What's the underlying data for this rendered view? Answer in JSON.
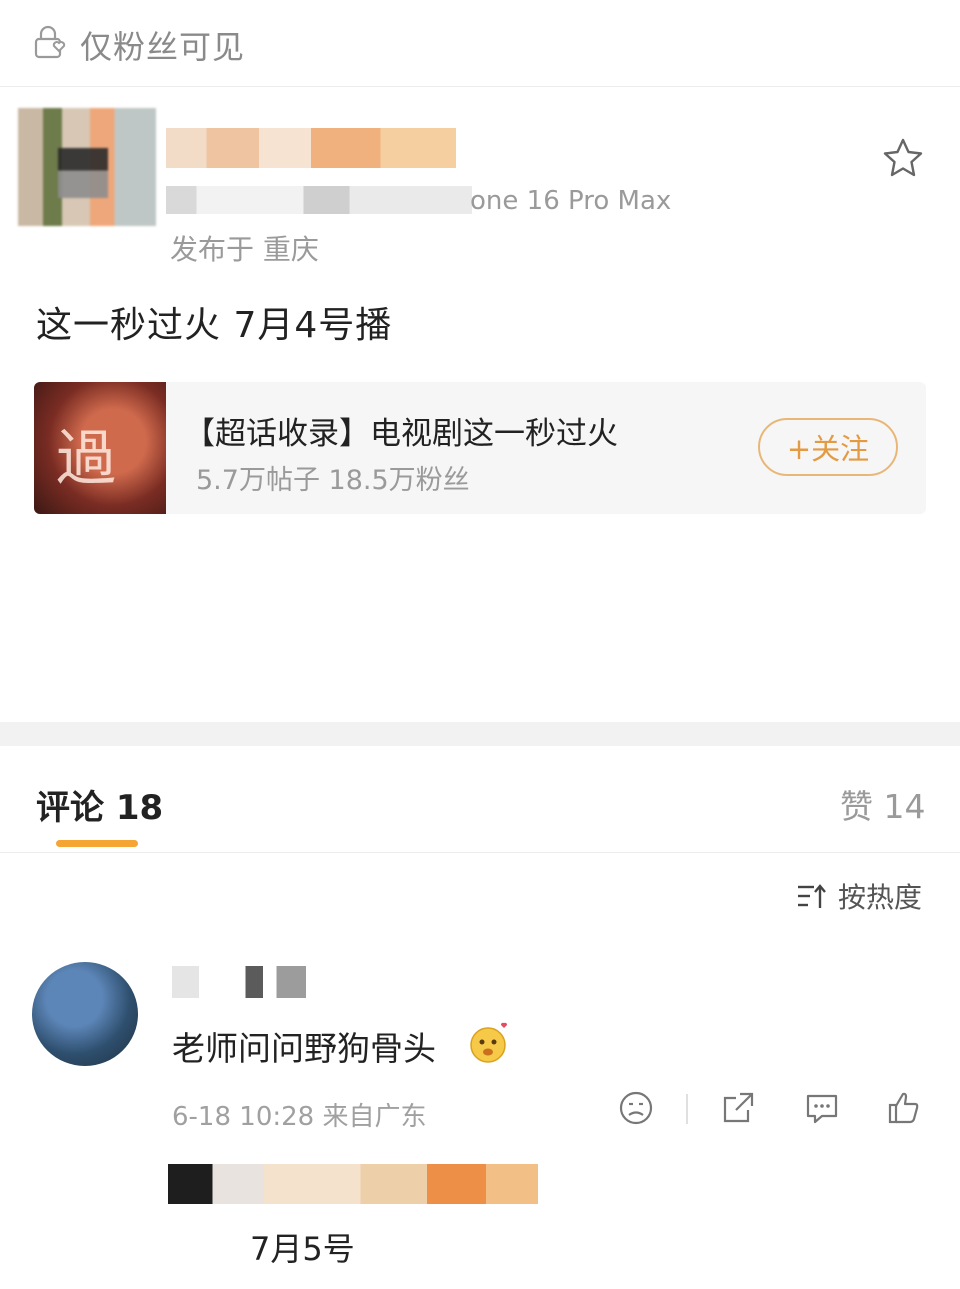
{
  "privacy": {
    "label": "仅粉丝可见"
  },
  "post": {
    "device_suffix": "one 16 Pro Max",
    "location": "发布于 重庆",
    "text": "这一秒过火 7月4号播"
  },
  "topic": {
    "thumb_text": "過火",
    "title": "【超话收录】电视剧这一秒过火",
    "meta": "5.7万帖子 18.5万粉丝",
    "follow_label": "+关注"
  },
  "comments_bar": {
    "comments_label": "评论 18",
    "likes_label": "赞 14",
    "sort_label": "按热度"
  },
  "comment": {
    "text": "老师问问野狗骨头",
    "meta": "6-18 10:28 来自广东"
  },
  "reply": {
    "text": "7月5号"
  },
  "colors": {
    "accent": "#f4a533",
    "follow": "#e39a42",
    "secondary_text": "#9a9a9a"
  },
  "icons": [
    "lock-heart-icon",
    "star-icon",
    "sort-icon",
    "dislike-face-icon",
    "share-icon",
    "comment-icon",
    "thumbs-up-icon",
    "emoji-icon"
  ]
}
